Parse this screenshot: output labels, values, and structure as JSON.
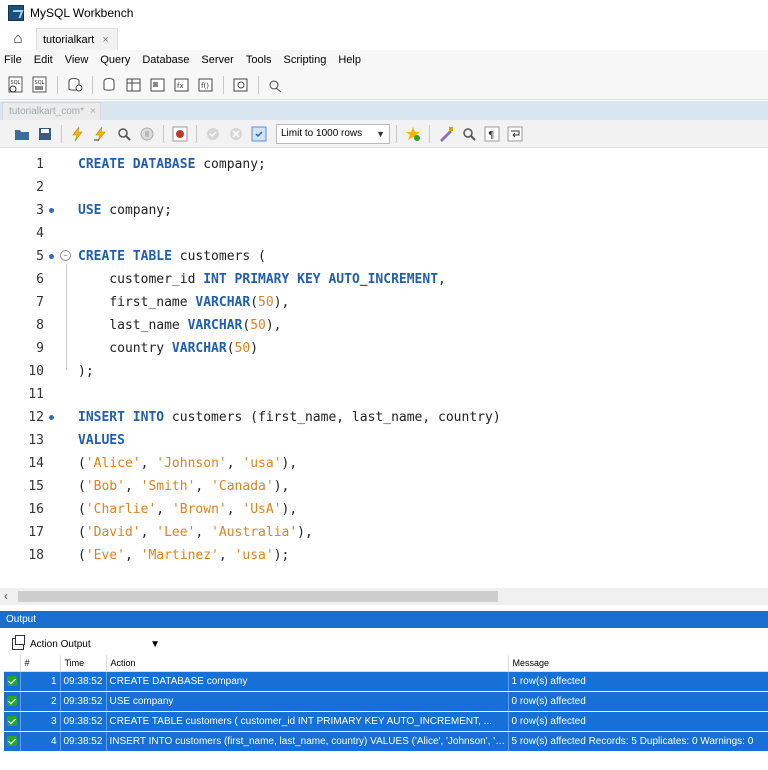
{
  "window": {
    "title": "MySQL Workbench"
  },
  "connection_tab": {
    "label": "tutorialkart",
    "close": "×"
  },
  "menu": [
    "File",
    "Edit",
    "View",
    "Query",
    "Database",
    "Server",
    "Tools",
    "Scripting",
    "Help"
  ],
  "editor_tab": {
    "label": "tutorialkart_com*",
    "close": "×"
  },
  "sql_toolbar": {
    "limit_label": "Limit to 1000 rows"
  },
  "editor": {
    "lines": [
      {
        "n": "1",
        "html": "<span class='kw'>CREATE DATABASE</span> company;"
      },
      {
        "n": "2",
        "html": ""
      },
      {
        "n": "3",
        "html": "<span class='kw'>USE</span> company;",
        "dot": true
      },
      {
        "n": "4",
        "html": ""
      },
      {
        "n": "5",
        "html": "<span class='kw'>CREATE TABLE</span> customers (",
        "dot": true,
        "fold": true
      },
      {
        "n": "6",
        "html": "    customer_id <span class='kw'>INT PRIMARY KEY AUTO_INCREMENT</span>,"
      },
      {
        "n": "7",
        "html": "    first_name <span class='kw'>VARCHAR</span>(<span class='num'>50</span>),"
      },
      {
        "n": "8",
        "html": "    last_name <span class='kw'>VARCHAR</span>(<span class='num'>50</span>),"
      },
      {
        "n": "9",
        "html": "    country <span class='kw'>VARCHAR</span>(<span class='num'>50</span>)"
      },
      {
        "n": "10",
        "html": ");"
      },
      {
        "n": "11",
        "html": ""
      },
      {
        "n": "12",
        "html": "<span class='kw'>INSERT INTO</span> customers (first_name, last_name, country)",
        "dot": true
      },
      {
        "n": "13",
        "html": "<span class='kw'>VALUES</span>"
      },
      {
        "n": "14",
        "html": "(<span class='str'>'Alice'</span>, <span class='str'>'Johnson'</span>, <span class='str'>'usa'</span>),"
      },
      {
        "n": "15",
        "html": "(<span class='str'>'Bob'</span>, <span class='str'>'Smith'</span>, <span class='str'>'Canada'</span>),"
      },
      {
        "n": "16",
        "html": "(<span class='str'>'Charlie'</span>, <span class='str'>'Brown'</span>, <span class='str'>'UsA'</span>),"
      },
      {
        "n": "17",
        "html": "(<span class='str'>'David'</span>, <span class='str'>'Lee'</span>, <span class='str'>'Australia'</span>),"
      },
      {
        "n": "18",
        "html": "(<span class='str'>'Eve'</span>, <span class='str'>'Martinez'</span>, <span class='str'>'usa'</span>);"
      }
    ]
  },
  "output": {
    "header": "Output",
    "selector": "Action Output",
    "columns": [
      "",
      "#",
      "Time",
      "Action",
      "Message"
    ],
    "rows": [
      {
        "num": "1",
        "time": "09:38:52",
        "action": "CREATE DATABASE company",
        "message": "1 row(s) affected"
      },
      {
        "num": "2",
        "time": "09:38:52",
        "action": "USE company",
        "message": "0 row(s) affected"
      },
      {
        "num": "3",
        "time": "09:38:52",
        "action": "CREATE TABLE customers (     customer_id INT PRIMARY KEY AUTO_INCREMENT,  ...",
        "message": "0 row(s) affected"
      },
      {
        "num": "4",
        "time": "09:38:52",
        "action": "INSERT INTO customers (first_name, last_name, country) VALUES ('Alice', 'Johnson', 'u...",
        "message": "5 row(s) affected Records: 5  Duplicates: 0  Warnings: 0"
      }
    ]
  },
  "colors": {
    "accent": "#1670d6",
    "keyword": "#1f5fb3",
    "literal": "#e4801b",
    "ok": "#2aa52a"
  }
}
